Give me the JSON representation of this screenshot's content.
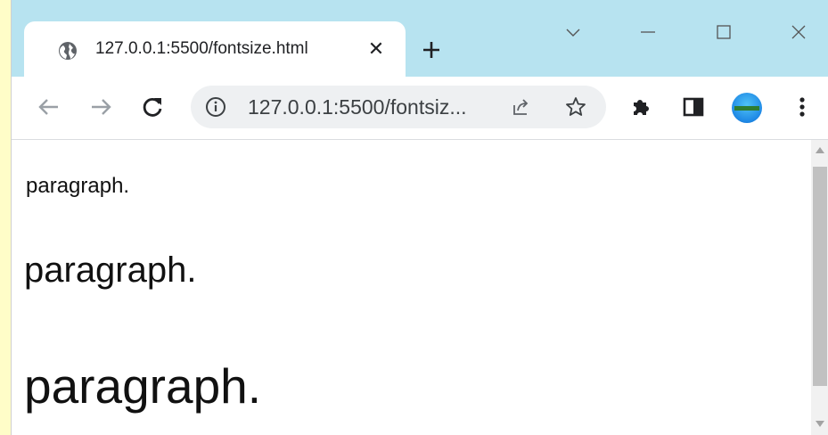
{
  "browser": {
    "tab": {
      "title": "127.0.0.1:5500/fontsize.html",
      "close_glyph": "✕",
      "icon": "globe-icon"
    },
    "new_tab_icon": "plus-icon",
    "window_controls": [
      "chevron-down-icon",
      "minimize-icon",
      "maximize-icon",
      "close-icon"
    ],
    "toolbar": {
      "back_icon": "back-arrow-icon",
      "forward_icon": "forward-arrow-icon",
      "reload_icon": "reload-icon",
      "address": {
        "info_icon": "info-icon",
        "url_display": "127.0.0.1:5500/fontsiz...",
        "share_icon": "share-icon",
        "bookmark_icon": "star-icon"
      },
      "extensions_icon": "puzzle-icon",
      "side_panel_icon": "side-panel-icon",
      "profile_icon": "avatar",
      "menu_icon": "kebab-menu-icon"
    },
    "colors": {
      "titlebar": "#b7e3f0",
      "desktop": "#fffdc8",
      "omnibox": "#eef0f2"
    }
  },
  "page": {
    "paragraphs": [
      {
        "text": "paragraph."
      },
      {
        "text": "paragraph."
      },
      {
        "text": "paragraph."
      }
    ]
  }
}
